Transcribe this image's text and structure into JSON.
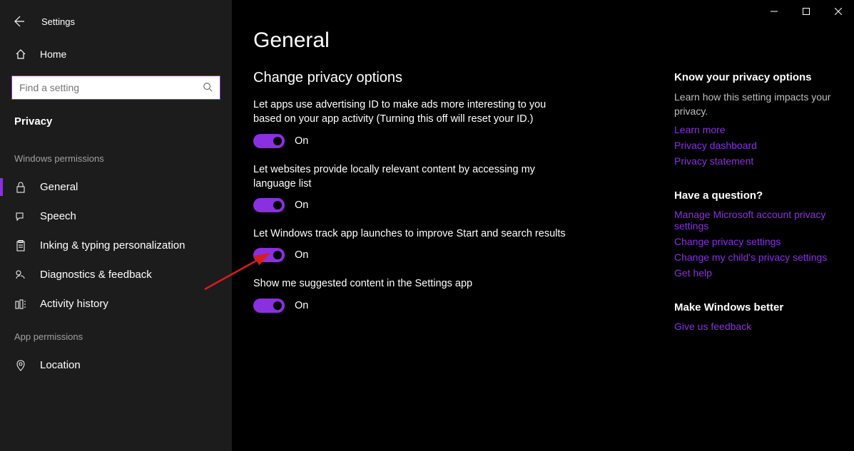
{
  "window": {
    "app_title": "Settings"
  },
  "sidebar": {
    "home": "Home",
    "search_placeholder": "Find a setting",
    "current": "Privacy",
    "section_win": "Windows permissions",
    "items_win": [
      "General",
      "Speech",
      "Inking & typing personalization",
      "Diagnostics & feedback",
      "Activity history"
    ],
    "section_app": "App permissions",
    "items_app": [
      "Location"
    ]
  },
  "page": {
    "title": "General",
    "section": "Change privacy options",
    "settings": [
      {
        "label": "Let apps use advertising ID to make ads more interesting to you based on your app activity (Turning this off will reset your ID.)",
        "state": "On"
      },
      {
        "label": "Let websites provide locally relevant content by accessing my language list",
        "state": "On"
      },
      {
        "label": "Let Windows track app launches to improve Start and search results",
        "state": "On"
      },
      {
        "label": "Show me suggested content in the Settings app",
        "state": "On"
      }
    ]
  },
  "aside": {
    "g1_title": "Know your privacy options",
    "g1_text": "Learn how this setting impacts your privacy.",
    "g1_links": [
      "Learn more",
      "Privacy dashboard",
      "Privacy statement"
    ],
    "g2_title": "Have a question?",
    "g2_links": [
      "Manage Microsoft account privacy settings",
      "Change privacy settings",
      "Change my child's privacy settings",
      "Get help"
    ],
    "g3_title": "Make Windows better",
    "g3_links": [
      "Give us feedback"
    ]
  }
}
